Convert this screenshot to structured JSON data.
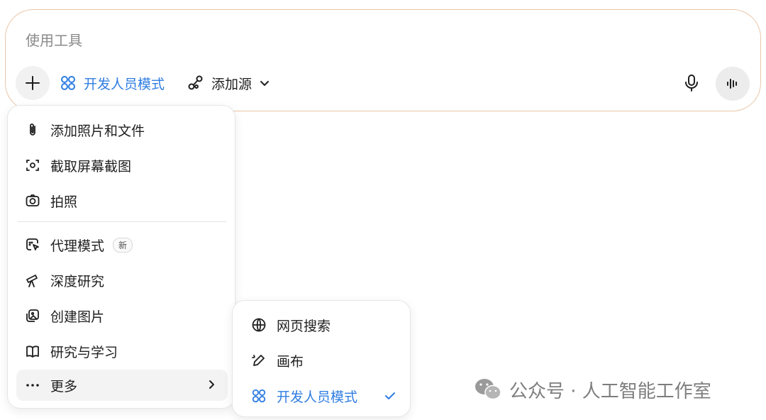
{
  "composer": {
    "placeholder": "使用工具",
    "dev_mode_label": "开发人员模式",
    "add_source_label": "添加源"
  },
  "menu": {
    "items": [
      {
        "label": "添加照片和文件",
        "icon": "paperclip-icon"
      },
      {
        "label": "截取屏幕截图",
        "icon": "screenshot-icon"
      },
      {
        "label": "拍照",
        "icon": "camera-icon"
      },
      {
        "label": "代理模式",
        "icon": "agent-cursor-icon",
        "badge": "新"
      },
      {
        "label": "深度研究",
        "icon": "telescope-icon"
      },
      {
        "label": "创建图片",
        "icon": "image-create-icon"
      },
      {
        "label": "研究与学习",
        "icon": "book-icon"
      },
      {
        "label": "更多",
        "icon": "ellipsis-icon"
      }
    ]
  },
  "submenu": {
    "items": [
      {
        "label": "网页搜索",
        "icon": "globe-icon"
      },
      {
        "label": "画布",
        "icon": "pen-sparkle-icon"
      },
      {
        "label": "开发人员模式",
        "icon": "dev-mode-icon",
        "checked": true
      }
    ]
  },
  "watermark": {
    "text": "公众号 · 人工智能工作室"
  },
  "colors": {
    "accent": "#2f7de1",
    "border": "#e9c6a8"
  }
}
